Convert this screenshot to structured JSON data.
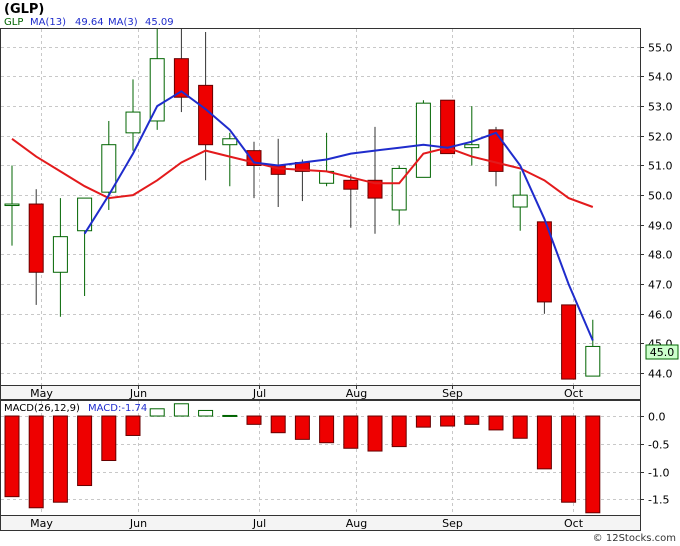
{
  "page_title": "(GLP)",
  "price_legend": {
    "symbol": "GLP",
    "ma13_label": "MA(13)",
    "ma13_value": "49.64",
    "ma3_label": "MA(3)",
    "ma3_value": "45.09"
  },
  "macd_legend": {
    "label": "MACD(26,12,9)",
    "value_label": "MACD:-1.74"
  },
  "watermark": "© 12Stocks.com",
  "last_price_label": "45.0",
  "colors": {
    "up": "#ffffff",
    "up_border": "#006400",
    "down": "#ee0000",
    "ma13": "#e31a1c",
    "ma3": "#1f2ccc",
    "grid": "#c8c8c8",
    "last_price_bg": "#ccffcc"
  },
  "chart_data": [
    {
      "type": "candlestick",
      "title": "(GLP)",
      "x_tick_labels": [
        {
          "label": "May",
          "index": 1.2
        },
        {
          "label": "Jun",
          "index": 5.2
        },
        {
          "label": "Jul",
          "index": 10.2
        },
        {
          "label": "Aug",
          "index": 14.2
        },
        {
          "label": "Sep",
          "index": 18.2
        },
        {
          "label": "Oct",
          "index": 23.2
        }
      ],
      "y_ticks": [
        44.0,
        45.0,
        46.0,
        47.0,
        48.0,
        49.0,
        50.0,
        51.0,
        52.0,
        53.0,
        54.0,
        55.0
      ],
      "ylim": [
        43.6,
        55.6
      ],
      "candles": [
        {
          "open": 49.7,
          "high": 51.0,
          "low": 48.3,
          "close": 49.7
        },
        {
          "open": 49.7,
          "high": 50.2,
          "low": 46.3,
          "close": 47.4
        },
        {
          "open": 47.4,
          "high": 49.9,
          "low": 45.9,
          "close": 48.6
        },
        {
          "open": 48.8,
          "high": 49.9,
          "low": 46.6,
          "close": 49.9
        },
        {
          "open": 50.1,
          "high": 52.5,
          "low": 49.5,
          "close": 51.7
        },
        {
          "open": 52.1,
          "high": 53.9,
          "low": 51.5,
          "close": 52.8
        },
        {
          "open": 52.5,
          "high": 55.6,
          "low": 52.2,
          "close": 54.6
        },
        {
          "open": 54.6,
          "high": 55.6,
          "low": 52.8,
          "close": 53.3
        },
        {
          "open": 53.7,
          "high": 55.5,
          "low": 50.5,
          "close": 51.7
        },
        {
          "open": 51.7,
          "high": 52.1,
          "low": 50.3,
          "close": 51.9
        },
        {
          "open": 51.5,
          "high": 51.8,
          "low": 49.9,
          "close": 51.0
        },
        {
          "open": 51.0,
          "high": 51.9,
          "low": 49.6,
          "close": 50.7
        },
        {
          "open": 51.1,
          "high": 51.2,
          "low": 49.8,
          "close": 50.8
        },
        {
          "open": 50.4,
          "high": 52.1,
          "low": 50.3,
          "close": 50.8
        },
        {
          "open": 50.5,
          "high": 50.7,
          "low": 48.9,
          "close": 50.2
        },
        {
          "open": 50.5,
          "high": 52.3,
          "low": 48.7,
          "close": 49.9
        },
        {
          "open": 49.5,
          "high": 51.0,
          "low": 49.0,
          "close": 50.9
        },
        {
          "open": 50.6,
          "high": 53.2,
          "low": 50.6,
          "close": 53.1
        },
        {
          "open": 53.2,
          "high": 53.2,
          "low": 51.4,
          "close": 51.4
        },
        {
          "open": 51.6,
          "high": 53.0,
          "low": 51.0,
          "close": 51.7
        },
        {
          "open": 52.2,
          "high": 52.3,
          "low": 50.3,
          "close": 50.8
        },
        {
          "open": 49.6,
          "high": 50.8,
          "low": 48.8,
          "close": 50.0
        },
        {
          "open": 49.1,
          "high": 49.1,
          "low": 46.0,
          "close": 46.4
        },
        {
          "open": 46.3,
          "high": 46.3,
          "low": 43.8,
          "close": 43.8
        },
        {
          "open": 43.9,
          "high": 45.8,
          "low": 43.9,
          "close": 44.9
        }
      ],
      "series": [
        {
          "name": "MA(13)",
          "points": [
            [
              0,
              51.9
            ],
            [
              1,
              51.3
            ],
            [
              2,
              50.8
            ],
            [
              3,
              50.3
            ],
            [
              4,
              49.9
            ],
            [
              5,
              50.0
            ],
            [
              6,
              50.5
            ],
            [
              7,
              51.1
            ],
            [
              8,
              51.5
            ],
            [
              9,
              51.3
            ],
            [
              10,
              51.1
            ],
            [
              11,
              50.9
            ],
            [
              12,
              50.85
            ],
            [
              13,
              50.8
            ],
            [
              14,
              50.6
            ],
            [
              15,
              50.4
            ],
            [
              16,
              50.4
            ],
            [
              17,
              51.4
            ],
            [
              18,
              51.6
            ],
            [
              19,
              51.3
            ],
            [
              20,
              51.1
            ],
            [
              21,
              50.9
            ],
            [
              22,
              50.5
            ],
            [
              23,
              49.9
            ],
            [
              24,
              49.6
            ]
          ]
        },
        {
          "name": "MA(3)",
          "points": [
            [
              3,
              48.7
            ],
            [
              4,
              50.0
            ],
            [
              5,
              51.4
            ],
            [
              6,
              53.0
            ],
            [
              7,
              53.5
            ],
            [
              8,
              52.9
            ],
            [
              9,
              52.2
            ],
            [
              10,
              51.1
            ],
            [
              11,
              51.0
            ],
            [
              12,
              51.1
            ],
            [
              13,
              51.2
            ],
            [
              14,
              51.4
            ],
            [
              15,
              51.5
            ],
            [
              16,
              51.6
            ],
            [
              17,
              51.7
            ],
            [
              18,
              51.6
            ],
            [
              19,
              51.8
            ],
            [
              20,
              52.1
            ],
            [
              21,
              51.0
            ],
            [
              22,
              49.2
            ],
            [
              23,
              47.0
            ],
            [
              24,
              45.1
            ]
          ]
        }
      ]
    },
    {
      "type": "bar",
      "title": "MACD(26,12,9)",
      "x_tick_labels": [
        {
          "label": "May",
          "index": 1.2
        },
        {
          "label": "Jun",
          "index": 5.2
        },
        {
          "label": "Jul",
          "index": 10.2
        },
        {
          "label": "Aug",
          "index": 14.2
        },
        {
          "label": "Sep",
          "index": 18.2
        },
        {
          "label": "Oct",
          "index": 23.2
        }
      ],
      "y_ticks": [
        0.0,
        -0.5,
        -1.0,
        -1.5
      ],
      "y_tick_labels": [
        "0.0",
        "-0.5",
        "-1.0",
        "-1.5"
      ],
      "ylim": [
        -1.78,
        0.27
      ],
      "values": [
        -1.45,
        -1.65,
        -1.55,
        -1.25,
        -0.8,
        -0.35,
        0.13,
        0.22,
        0.1,
        0.01,
        -0.15,
        -0.3,
        -0.42,
        -0.48,
        -0.58,
        -0.63,
        -0.55,
        -0.2,
        -0.18,
        -0.15,
        -0.25,
        -0.4,
        -0.95,
        -1.55,
        -1.74
      ]
    }
  ]
}
